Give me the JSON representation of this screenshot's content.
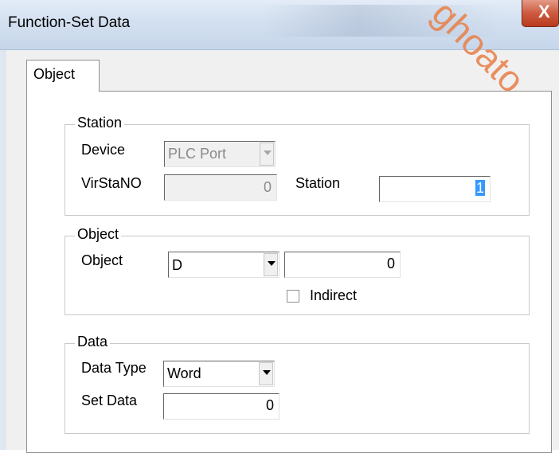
{
  "window": {
    "title": "Function-Set Data",
    "close_glyph": "X"
  },
  "tabs": [
    {
      "label": "Object",
      "selected": true
    }
  ],
  "station_group": {
    "title": "Station",
    "device_label": "Device",
    "device_value": "PLC Port",
    "virstano_label": "VirStaNO",
    "virstano_value": "0",
    "station_label": "Station",
    "station_value": "1"
  },
  "object_group": {
    "title": "Object",
    "object_label": "Object",
    "object_type": "D",
    "object_address": "0",
    "indirect_label": "Indirect",
    "indirect_checked": false
  },
  "data_group": {
    "title": "Data",
    "data_type_label": "Data Type",
    "data_type_value": "Word",
    "set_data_label": "Set Data",
    "set_data_value": "0"
  },
  "watermark": {
    "text": "ghoato",
    "color": "#e8834f"
  }
}
